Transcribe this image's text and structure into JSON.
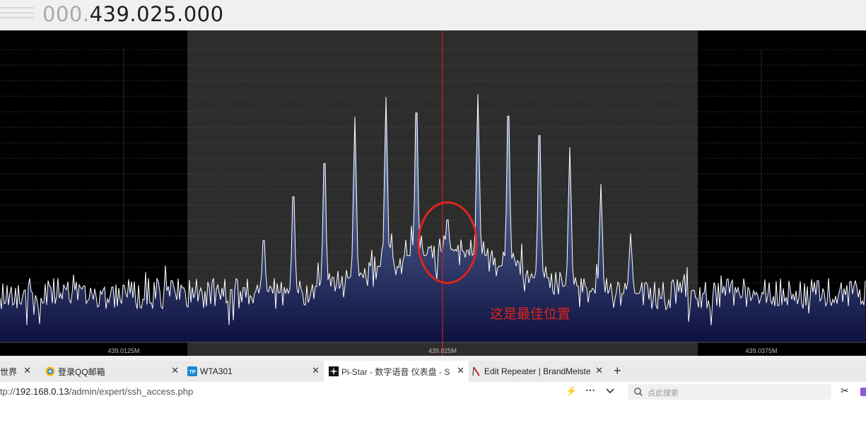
{
  "frequency": {
    "dim": "000.",
    "bright": "439.025.000"
  },
  "spectrum": {
    "freq_labels": [
      "439.0125M",
      "439.025M",
      "439.0375M"
    ],
    "annotation": "这是最佳位置",
    "colors": {
      "background": "#000000",
      "passband": "#2d2d2d",
      "center_line": "#e0241b",
      "trace": "#ffffff",
      "fill_top": "#7b98c7",
      "fill_bottom": "#0e1140",
      "annotation": "#e0241b"
    }
  },
  "tabs": [
    {
      "label": "世界",
      "favicon": "globe-icon"
    },
    {
      "label": "登录QQ邮箱",
      "favicon": "qq-mail-icon"
    },
    {
      "label": "WTA301",
      "favicon": "tp-link-icon"
    },
    {
      "label": "Pi-Star - 数字语音 仪表盘 - S",
      "favicon": "pi-star-icon",
      "active": true
    },
    {
      "label": "Edit Repeater | BrandMeiste",
      "favicon": "brandmeister-icon"
    }
  ],
  "new_tab": "+",
  "url": {
    "prefix": "tp://",
    "host": "192.168.0.13",
    "path": "/admin/expert/ssh_access.php"
  },
  "search_placeholder": "点此搜索"
}
